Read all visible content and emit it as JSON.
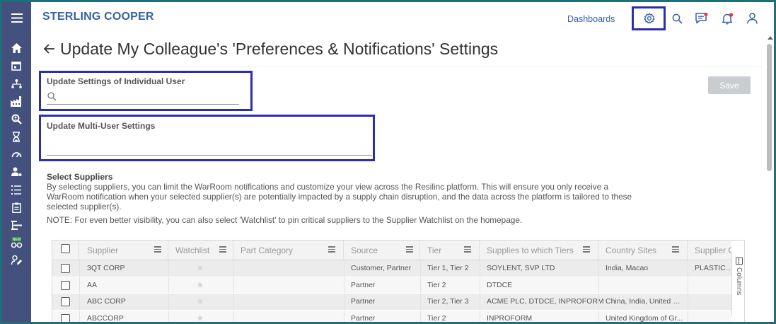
{
  "header": {
    "brand": "STERLING COOPER",
    "dashboards_link": "Dashboards",
    "icons": [
      "gear-icon",
      "search-icon",
      "feedback-icon",
      "bell-icon",
      "user-icon"
    ],
    "accent": "#3562a8"
  },
  "sidebar": {
    "background": "#44507e",
    "icons": [
      "home-icon",
      "calendar-icon",
      "network-icon",
      "factory-icon",
      "search-person-icon",
      "hourglass-icon",
      "gauge-icon",
      "person-settings-icon",
      "list-icon",
      "clipboard-icon",
      "hierarchy-icon",
      "new-badge-icon",
      "user-edit-icon"
    ],
    "new_badge": "NEW"
  },
  "page": {
    "title": "Update My Colleague's 'Preferences & Notifications' Settings",
    "individual_label": "Update Settings of Individual User",
    "individual_placeholder": "",
    "multi_label": "Update Multi-User Settings",
    "save_button": "Save"
  },
  "suppliers_section": {
    "title": "Select Suppliers",
    "description": "By selecting suppliers, you can limit the WarRoom notifications and customize your view across the Resilinc platform. This will ensure you only receive a WarRoom notification when your selected supplier(s) are potentially impacted by a supply chain disruption, and the data across the platform is tailored to these selected supplier(s).",
    "note": "NOTE: For even better visibility, you can also select 'Watchlist' to pin critical suppliers to the Supplier Watchlist on the homepage."
  },
  "grid": {
    "columns": [
      "Supplier",
      "Watchlist",
      "Part Category",
      "Source",
      "Tier",
      "Supplies to which Tiers",
      "Country Sites",
      "Supplier C"
    ],
    "side_tab": "Columns",
    "rows": [
      {
        "supplier": "3QT CORP",
        "part_category": "",
        "source": "Customer, Partner",
        "tier": "Tier 1, Tier 2",
        "supplies_to": "SOYLENT, SVP LTD",
        "country_sites": "India, Macao",
        "supplier_c": "PLASTICS &"
      },
      {
        "supplier": "AA",
        "part_category": "",
        "source": "Partner",
        "tier": "Tier 2",
        "supplies_to": "DTDCE",
        "country_sites": "",
        "supplier_c": ""
      },
      {
        "supplier": "ABC CORP",
        "part_category": "",
        "source": "Partner",
        "tier": "Tier 2, Tier 3",
        "supplies_to": "ACME PLC, DTDCE, INPROFORM",
        "country_sites": "China, India, United Ki...",
        "supplier_c": ""
      },
      {
        "supplier": "ABCCORP",
        "part_category": "",
        "source": "Partner",
        "tier": "Tier 2",
        "supplies_to": "INPROFORM",
        "country_sites": "United Kingdom of Gr...",
        "supplier_c": ""
      }
    ]
  }
}
